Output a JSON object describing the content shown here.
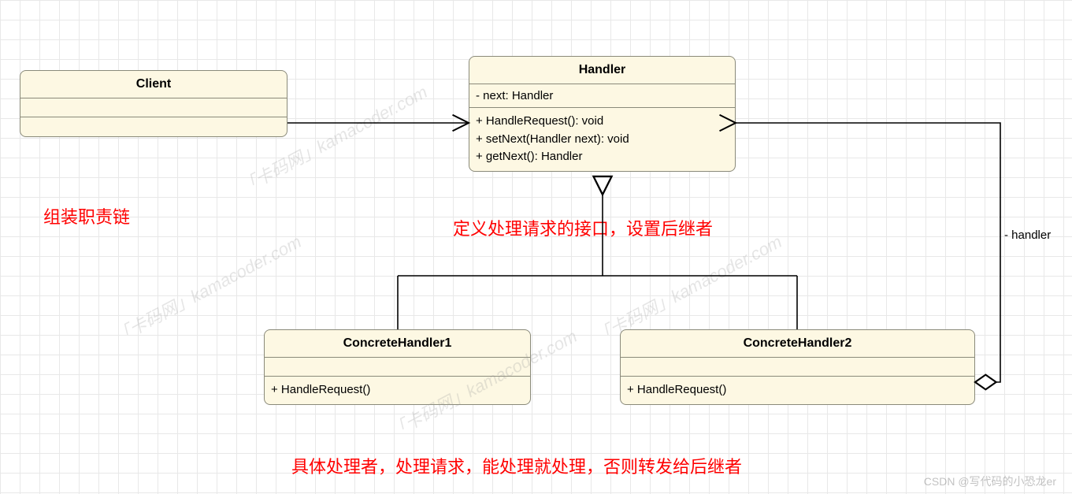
{
  "diagram": {
    "classes": {
      "client": {
        "name": "Client",
        "attrs": "",
        "ops": ""
      },
      "handler": {
        "name": "Handler",
        "attrs": "- next: Handler",
        "ops_1": "+ HandleRequest(): void",
        "ops_2": "+ setNext(Handler next): void",
        "ops_3": "+ getNext(): Handler"
      },
      "concrete1": {
        "name": "ConcreteHandler1",
        "attrs": "",
        "ops": "+ HandleRequest()"
      },
      "concrete2": {
        "name": "ConcreteHandler2",
        "attrs": "",
        "ops": "+ HandleRequest()"
      }
    },
    "edges": {
      "handler_self": "- handler"
    },
    "notes": {
      "client": "组装职责链",
      "handler": "定义处理请求的接口，设置后继者",
      "concrete": "具体处理者，处理请求，能处理就处理，否则转发给后继者"
    },
    "watermark": "「卡码网」kamacoder.com",
    "credit": "CSDN @写代码的小恐龙er"
  }
}
